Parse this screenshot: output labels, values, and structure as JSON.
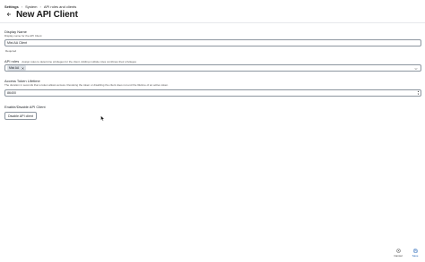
{
  "breadcrumb": {
    "items": [
      "Settings",
      "System",
      "API roles and clients"
    ]
  },
  "header": {
    "title": "New API Client"
  },
  "form": {
    "display_name": {
      "label": "Display Name",
      "help": "Display name for the API Client",
      "value": "Mist AA Client",
      "required_note": "Required"
    },
    "api_roles": {
      "label": "API roles",
      "help": "Assign roles to determine privileges for the client. Adding multiple roles combines their privileges",
      "selected": [
        "Mist AA"
      ]
    },
    "access_token_lifetime": {
      "label": "Access Token Lifetime",
      "help": "The duration in seconds that a token allows access. Revoking the token or disabling the client does not end the lifetime of an active token.",
      "value": "86400"
    },
    "enable_disable": {
      "label": "Enable/Disable API Client",
      "button_label": "Disable API client"
    }
  },
  "footer": {
    "cancel_label": "Cancel",
    "save_label": "Save"
  },
  "icons": {
    "back": "arrow-left-icon",
    "remove_chip": "close-icon",
    "dropdown": "chevron-down-icon",
    "cancel": "cancel-icon",
    "save": "save-icon"
  },
  "colors": {
    "accent": "#1a5fb4",
    "border": "#8c959f",
    "chip_bg": "#dfe3e8"
  }
}
